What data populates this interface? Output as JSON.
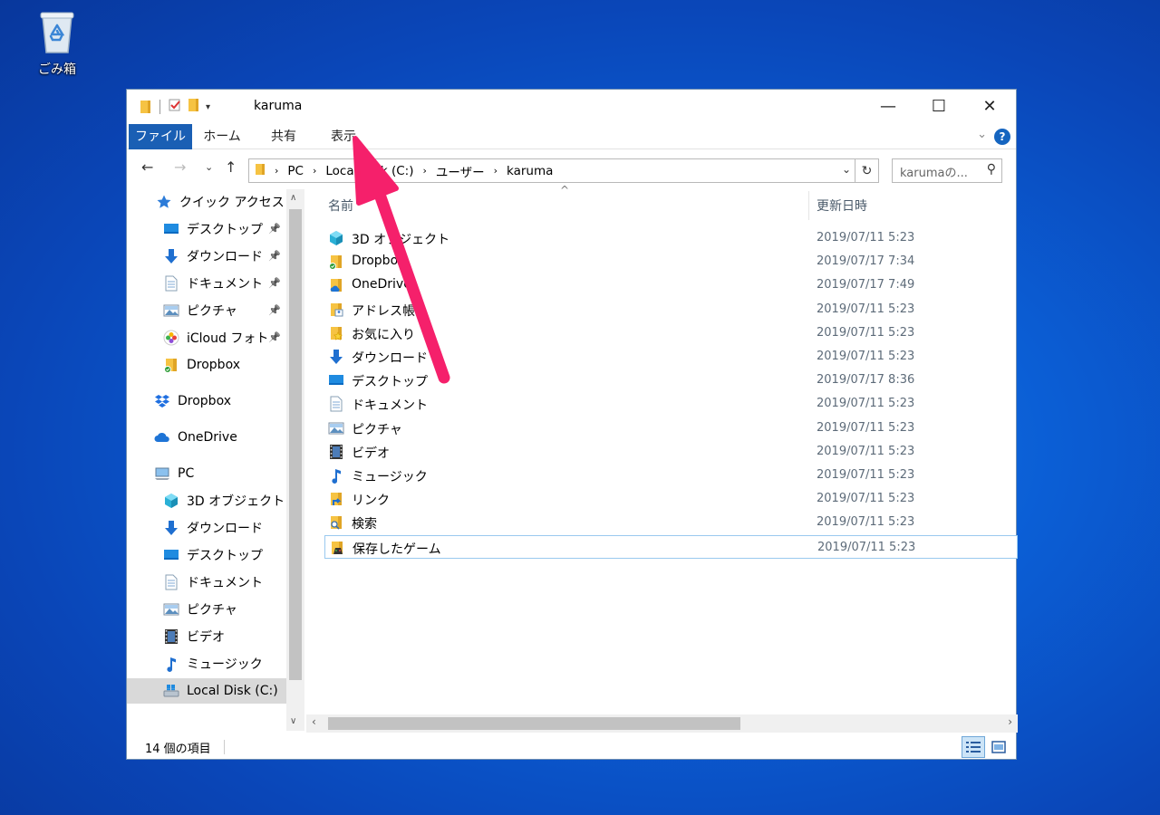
{
  "desktop": {
    "recycle_bin_label": "ごみ箱"
  },
  "window": {
    "title": "karuma",
    "controls": {
      "minimize": "—",
      "maximize": "☐",
      "close": "✕"
    }
  },
  "ribbon": {
    "tabs": [
      "ファイル",
      "ホーム",
      "共有",
      "表示"
    ],
    "help": "?"
  },
  "address": {
    "segments": [
      "PC",
      "Local Disk (C:)",
      "ユーザー",
      "karuma"
    ],
    "search_placeholder": "karumaの..."
  },
  "sidebar": {
    "items": [
      {
        "label": "クイック アクセス",
        "icon": "star-icon",
        "pinned": false
      },
      {
        "label": "デスクトップ",
        "icon": "desktop-icon",
        "pinned": true
      },
      {
        "label": "ダウンロード",
        "icon": "download-icon",
        "pinned": true
      },
      {
        "label": "ドキュメント",
        "icon": "document-icon",
        "pinned": true
      },
      {
        "label": "ピクチャ",
        "icon": "picture-icon",
        "pinned": true
      },
      {
        "label": "iCloud フォト",
        "icon": "icloud-photos-icon",
        "pinned": true
      },
      {
        "label": "Dropbox",
        "icon": "dropbox-folder-icon",
        "pinned": false
      },
      {
        "label": "Dropbox",
        "icon": "dropbox-icon",
        "pinned": false
      },
      {
        "label": "OneDrive",
        "icon": "onedrive-icon",
        "pinned": false
      },
      {
        "label": "PC",
        "icon": "pc-icon",
        "pinned": false
      },
      {
        "label": "3D オブジェクト",
        "icon": "3d-objects-icon",
        "pinned": false
      },
      {
        "label": "ダウンロード",
        "icon": "download-icon",
        "pinned": false
      },
      {
        "label": "デスクトップ",
        "icon": "desktop-icon",
        "pinned": false
      },
      {
        "label": "ドキュメント",
        "icon": "document-icon",
        "pinned": false
      },
      {
        "label": "ピクチャ",
        "icon": "picture-icon",
        "pinned": false
      },
      {
        "label": "ビデオ",
        "icon": "video-icon",
        "pinned": false
      },
      {
        "label": "ミュージック",
        "icon": "music-icon",
        "pinned": false
      },
      {
        "label": "Local Disk (C:)",
        "icon": "local-disk-icon",
        "pinned": false
      }
    ]
  },
  "list": {
    "columns": {
      "name": "名前",
      "modified": "更新日時"
    },
    "rows": [
      {
        "name": "3D オブジェクト",
        "date": "2019/07/11 5:23",
        "icon": "3d-objects-icon"
      },
      {
        "name": "Dropbox",
        "date": "2019/07/17 7:34",
        "icon": "dropbox-folder-icon"
      },
      {
        "name": "OneDrive",
        "date": "2019/07/17 7:49",
        "icon": "onedrive-folder-icon"
      },
      {
        "name": "アドレス帳",
        "date": "2019/07/11 5:23",
        "icon": "contacts-icon"
      },
      {
        "name": "お気に入り",
        "date": "2019/07/11 5:23",
        "icon": "favorites-icon"
      },
      {
        "name": "ダウンロード",
        "date": "2019/07/11 5:23",
        "icon": "download-icon"
      },
      {
        "name": "デスクトップ",
        "date": "2019/07/17 8:36",
        "icon": "desktop-icon"
      },
      {
        "name": "ドキュメント",
        "date": "2019/07/11 5:23",
        "icon": "document-icon"
      },
      {
        "name": "ピクチャ",
        "date": "2019/07/11 5:23",
        "icon": "picture-icon"
      },
      {
        "name": "ビデオ",
        "date": "2019/07/11 5:23",
        "icon": "video-icon"
      },
      {
        "name": "ミュージック",
        "date": "2019/07/11 5:23",
        "icon": "music-icon"
      },
      {
        "name": "リンク",
        "date": "2019/07/11 5:23",
        "icon": "links-icon"
      },
      {
        "name": "検索",
        "date": "2019/07/11 5:23",
        "icon": "search-folder-icon"
      },
      {
        "name": "保存したゲーム",
        "date": "2019/07/11 5:23",
        "icon": "saved-games-icon"
      }
    ],
    "selected_index": 13
  },
  "status": {
    "item_count": "14 個の項目"
  },
  "colors": {
    "accent": "#1a5fb4",
    "annotation_arrow": "#f5206b",
    "selection_border": "#99c9ef"
  }
}
